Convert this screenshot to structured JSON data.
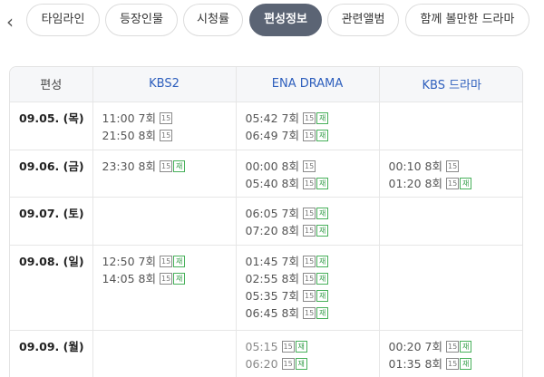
{
  "tabs": [
    {
      "label": "타임라인",
      "active": false
    },
    {
      "label": "등장인물",
      "active": false
    },
    {
      "label": "시청률",
      "active": false
    },
    {
      "label": "편성정보",
      "active": true
    },
    {
      "label": "관련앨범",
      "active": false
    },
    {
      "label": "함께 볼만한 드라마",
      "active": false
    }
  ],
  "prev_glyph": "‹",
  "table": {
    "headers": [
      "편성",
      "KBS2",
      "ENA DRAMA",
      "KBS 드라마"
    ],
    "rows": [
      {
        "date": "09.05. (목)",
        "cells": [
          [
            {
              "time": "11:00",
              "ep": "7회",
              "age": "15",
              "re": ""
            },
            {
              "time": "21:50",
              "ep": "8회",
              "age": "15",
              "re": ""
            }
          ],
          [
            {
              "time": "05:42",
              "ep": "7회",
              "age": "15",
              "re": "재"
            },
            {
              "time": "06:49",
              "ep": "7회",
              "age": "15",
              "re": "재"
            }
          ],
          []
        ]
      },
      {
        "date": "09.06. (금)",
        "cells": [
          [
            {
              "time": "23:30",
              "ep": "8회",
              "age": "15",
              "re": "재"
            }
          ],
          [
            {
              "time": "00:00",
              "ep": "8회",
              "age": "15",
              "re": ""
            },
            {
              "time": "05:40",
              "ep": "8회",
              "age": "15",
              "re": "재"
            }
          ],
          [
            {
              "time": "00:10",
              "ep": "8회",
              "age": "15",
              "re": ""
            },
            {
              "time": "01:20",
              "ep": "8회",
              "age": "15",
              "re": "재"
            }
          ]
        ]
      },
      {
        "date": "09.07. (토)",
        "cells": [
          [],
          [
            {
              "time": "06:05",
              "ep": "7회",
              "age": "15",
              "re": "재"
            },
            {
              "time": "07:20",
              "ep": "8회",
              "age": "15",
              "re": "재"
            }
          ],
          []
        ]
      },
      {
        "date": "09.08. (일)",
        "cells": [
          [
            {
              "time": "12:50",
              "ep": "7회",
              "age": "15",
              "re": "재"
            },
            {
              "time": "14:05",
              "ep": "8회",
              "age": "15",
              "re": "재"
            }
          ],
          [
            {
              "time": "01:45",
              "ep": "7회",
              "age": "15",
              "re": "재"
            },
            {
              "time": "02:55",
              "ep": "8회",
              "age": "15",
              "re": "재"
            },
            {
              "time": "05:35",
              "ep": "7회",
              "age": "15",
              "re": "재"
            },
            {
              "time": "06:45",
              "ep": "8회",
              "age": "15",
              "re": "재"
            }
          ],
          []
        ]
      },
      {
        "date": "09.09. (월)",
        "cells": [
          [],
          [
            {
              "time": "05:15",
              "ep": "",
              "age": "15",
              "re": "재"
            },
            {
              "time": "06:20",
              "ep": "",
              "age": "15",
              "re": "재"
            }
          ],
          [
            {
              "time": "00:20",
              "ep": "7회",
              "age": "15",
              "re": "재"
            },
            {
              "time": "01:35",
              "ep": "8회",
              "age": "15",
              "re": "재"
            }
          ]
        ]
      }
    ]
  },
  "colors": {
    "network_header": "#2e5fbd",
    "active_tab": "#5b6474",
    "rerun_badge": "#47b05a"
  }
}
